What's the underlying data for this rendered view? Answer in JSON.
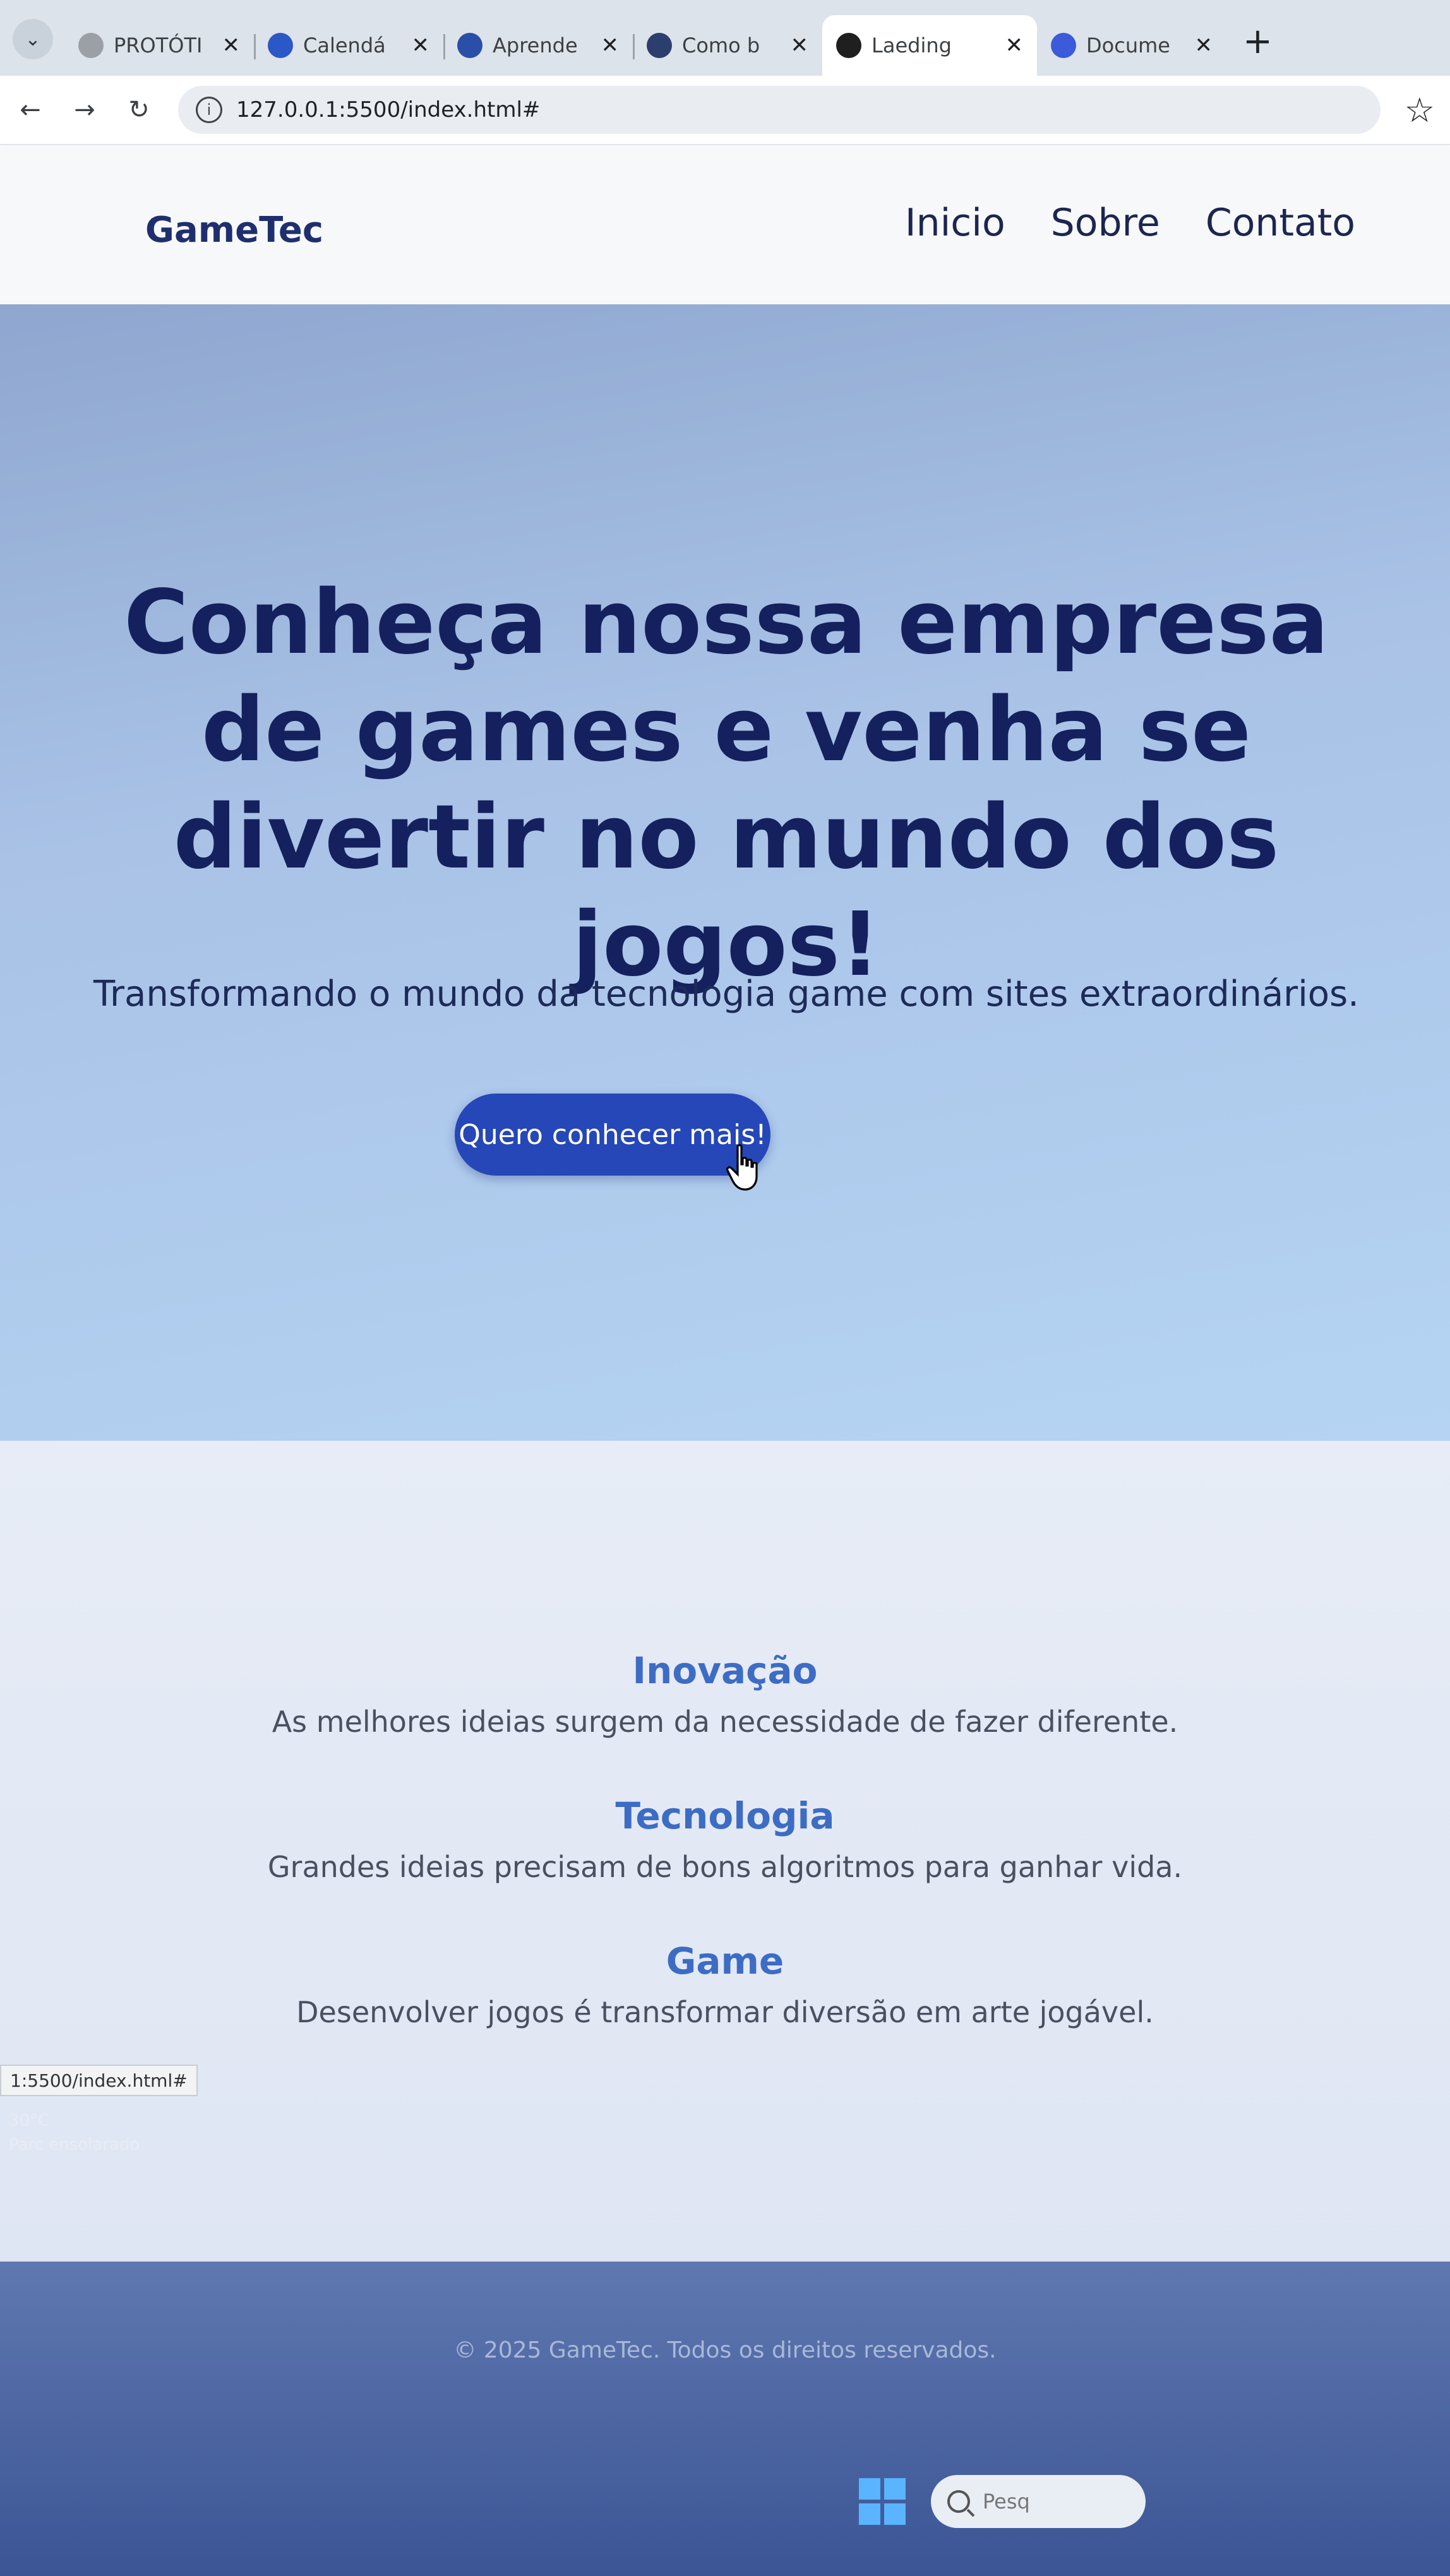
{
  "browser": {
    "tabs": [
      {
        "label": "PROTÓTI",
        "favicon": "document-icon",
        "color": "#9aa0a6",
        "active": false
      },
      {
        "label": "Calendá",
        "favicon": "calendar-icon",
        "color": "#2b58c7",
        "active": false
      },
      {
        "label": "Aprende",
        "favicon": "globe-icon",
        "color": "#2a4fa8",
        "active": false
      },
      {
        "label": "Como b",
        "favicon": "globe-icon",
        "color": "#2b3e6e",
        "active": false
      },
      {
        "label": "Laeding",
        "favicon": "globe-icon",
        "color": "#1f1f1f",
        "active": true
      },
      {
        "label": "Docume",
        "favicon": "docs-icon",
        "color": "#3b5bdb",
        "active": false
      }
    ],
    "new_tab": "+",
    "url": "127.0.0.1:5500/index.html#"
  },
  "header": {
    "logo": "GameTec",
    "menu": [
      "Inicio",
      "Sobre",
      "Contato"
    ]
  },
  "hero": {
    "title": "Conheça nossa empresa de games e venha se divertir no mundo dos jogos!",
    "subtitle": "Transformando o mundo da tecnologia game com sites extraordinários.",
    "cta": "Quero conhecer mais!"
  },
  "features": [
    {
      "title": "Inovação",
      "description": "As melhores ideias surgem da necessidade de fazer diferente."
    },
    {
      "title": "Tecnologia",
      "description": "Grandes ideias precisam de bons algoritmos para ganhar vida."
    },
    {
      "title": "Game",
      "description": "Desenvolver jogos é transformar diversão em arte jogável."
    }
  ],
  "footer": {
    "text": "© 2025 GameTec. Todos os direitos reservados."
  },
  "status": {
    "url": "1:5500/index.html#",
    "temperature": "30°C",
    "condition": "Parc ensolarado",
    "search_placeholder": "Pesq"
  },
  "colors": {
    "brand": "#1f2f6e",
    "accent": "#2547b8",
    "feature_title": "#3d6cc4"
  }
}
